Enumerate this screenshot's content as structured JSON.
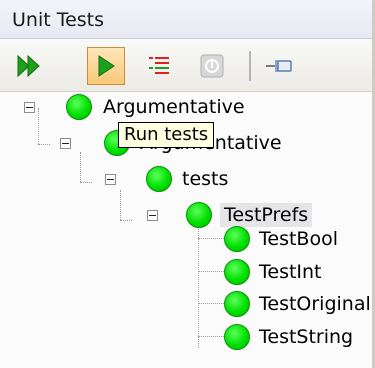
{
  "panel": {
    "title": "Unit Tests"
  },
  "toolbar": {
    "buttons": [
      {
        "name": "run-all",
        "icon": "double-play-icon",
        "color": "#12a012"
      },
      {
        "name": "run",
        "icon": "play-icon",
        "color": "#12a012",
        "pressed": true
      },
      {
        "name": "list",
        "icon": "test-list-icon",
        "color": "#e02020"
      },
      {
        "name": "stop",
        "icon": "stop-icon",
        "disabled": true
      },
      {
        "name": "pin",
        "icon": "pin-icon"
      }
    ]
  },
  "tooltip": {
    "text": "Run tests"
  },
  "tree": {
    "nodes": [
      {
        "label": "Argumentative",
        "status": "passed"
      },
      {
        "label": "Argumentative",
        "status": "passed"
      },
      {
        "label": "tests",
        "status": "passed"
      },
      {
        "label": "TestPrefs",
        "status": "passed",
        "selected": true
      },
      {
        "label": "TestBool",
        "status": "passed"
      },
      {
        "label": "TestInt",
        "status": "passed"
      },
      {
        "label": "TestOriginal",
        "status": "passed"
      },
      {
        "label": "TestString",
        "status": "passed"
      }
    ]
  },
  "colors": {
    "passed": "#00e000",
    "tooltip_bg": "#ffffe1",
    "selected_bg": "#e5e5e8"
  }
}
